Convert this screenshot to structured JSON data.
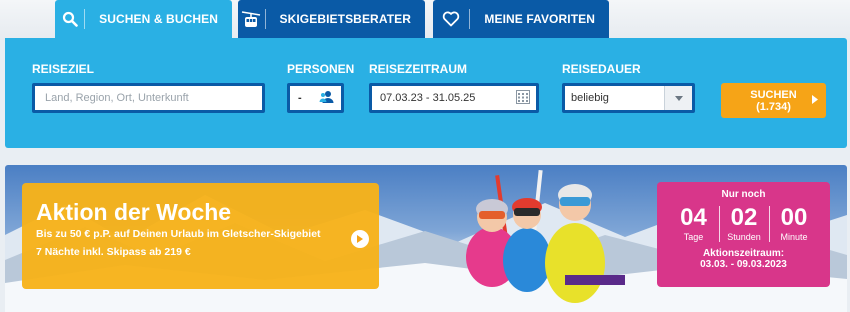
{
  "tabs": [
    {
      "label": "SUCHEN & BUCHEN",
      "icon": "search-icon",
      "active": true
    },
    {
      "label": "SKIGEBIETSBERATER",
      "icon": "gondola-icon",
      "active": false
    },
    {
      "label": "MEINE FAVORITEN",
      "icon": "heart-icon",
      "active": false
    }
  ],
  "search": {
    "destination_label": "REISEZIEL",
    "destination_placeholder": "Land, Region, Ort, Unterkunft",
    "persons_label": "PERSONEN",
    "persons_value": "-",
    "period_label": "REISEZEITRAUM",
    "period_value": "07.03.23 - 31.05.25",
    "duration_label": "REISEDAUER",
    "duration_value": "beliebig",
    "button_label": "SUCHEN",
    "button_count": "(1.734)"
  },
  "promo": {
    "title": "Aktion der Woche",
    "line1": "Bis zu 50 € p.P. auf Deinen Urlaub im Gletscher-Skigebiet",
    "line2": "7 Nächte inkl. Skipass ab 219 €"
  },
  "countdown": {
    "header": "Nur noch",
    "days": "04",
    "days_label": "Tage",
    "hours": "02",
    "hours_label": "Stunden",
    "minutes": "00",
    "minutes_label": "Minute",
    "period_label": "Aktionszeitraum:",
    "period": "03.03. - 09.03.2023"
  },
  "colors": {
    "tab_inactive": "#0a5aa6",
    "tab_active": "#2ab0e4",
    "search_button": "#f6a417",
    "promo": "#f7b219",
    "countdown": "#d8368a"
  }
}
